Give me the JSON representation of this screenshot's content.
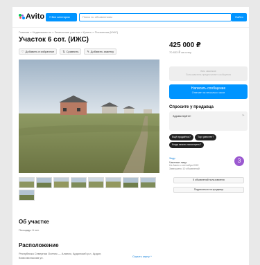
{
  "header": {
    "logo": "Avito",
    "categories_button": "Все категории",
    "search_placeholder": "Поиск по объявлениям",
    "find_button": "Найти",
    "colors": {
      "accent": "#0094ff"
    }
  },
  "breadcrumbs": "Главная » Недвижимость » Земельные участки » Купить » Поселения (ИЖС)",
  "title": "Участок 6 сот. (ИЖС)",
  "actions": [
    {
      "icon": "heart-icon",
      "label": "Добавить в избранное"
    },
    {
      "icon": "compare-icon",
      "label": "Сравнить"
    },
    {
      "icon": "note-icon",
      "label": "Добавить заметку"
    }
  ],
  "thumbnails_count": 9,
  "about": {
    "title": "Об участке",
    "text": "Площадь: 6 сот."
  },
  "location": {
    "title": "Расположение",
    "address": "Республика Северная Осетия — Алания, Ардонский р-н, Ардон,",
    "street": "Комсомольская ул.",
    "map_link": "Скрыть карту ^"
  },
  "sidebar": {
    "price": "425 000 ₽",
    "per_unit": "70 833 ₽ за сотку",
    "call_button": {
      "label": "Без звонков",
      "sub": "Пользователь предпочитает сообщения"
    },
    "message_button": {
      "label": "Написать сообщение",
      "sub": "Отвечает за несколько часов"
    },
    "ask_title": "Спросите у продавца",
    "ask_text": "Здравствуйте!",
    "chips": [
      "Ещё продаётся?",
      "Торг уместен?",
      "Когда можно посмотреть?"
    ],
    "seller": {
      "name": "Заур",
      "type": "Частное лицо",
      "since": "На Авито с сентября 2022",
      "completed": "Завершено 10 объявлений",
      "avatar_letter": "З",
      "avatar_color": "#9b59d0"
    },
    "all_ads_button": "5 объявлений пользователя",
    "subscribe_button": "Подписаться на продавца"
  }
}
